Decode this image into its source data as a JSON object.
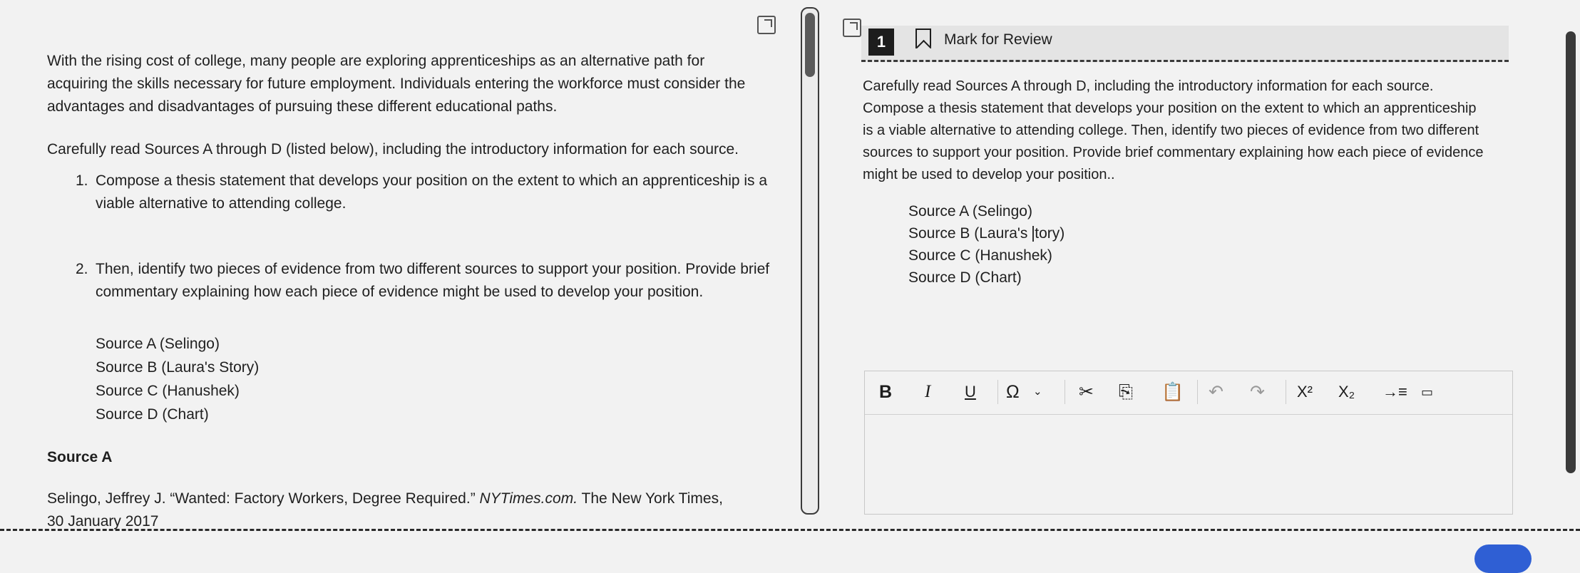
{
  "left": {
    "intro": "With the rising cost of college, many people are exploring apprenticeships as an alternative path for acquiring the skills necessary for future employment. Individuals entering the workforce must consider the advantages and disadvantages of pursuing these different educational paths.",
    "instruction": "Carefully read Sources A through D (listed below), including the introductory information for each source.",
    "steps": [
      {
        "number": "1.",
        "text": "Compose a thesis statement that develops your position on the extent to which an apprenticeship is a viable alternative to attending college."
      },
      {
        "number": "2.",
        "text": "Then, identify two pieces of evidence from two different sources to support your position. Provide brief commentary explaining how each piece of evidence might be used to develop your position."
      }
    ],
    "sources": [
      "Source A (Selingo)",
      "Source B (Laura's Story)",
      "Source C (Hanushek)",
      "Source D (Chart)"
    ],
    "source_a_heading": "Source A",
    "citation_prefix": "Selingo, Jeffrey J. “Wanted: Factory Workers, Degree Required.” ",
    "citation_italic": "NYTimes.com.",
    "citation_suffix": " The New York Times, 30 January 2017"
  },
  "question": {
    "number": "1",
    "mark_label": "Mark for Review",
    "prompt": "Carefully read Sources A through D, including the introductory information for each source. Compose a thesis statement that develops your position on the extent to which an apprenticeship is a viable alternative to attending college. Then, identify two pieces of evidence from two different sources to support your position. Provide brief commentary explaining how each piece of evidence might be used to develop your position..",
    "sources": {
      "a": "Source A (Selingo)",
      "b_before": "Source B (Laura's ",
      "b_after": "tory)",
      "c": "Source C (Hanushek)",
      "d": "Source D (Chart)"
    }
  },
  "editor": {
    "toolbar": {
      "bold": "B",
      "italic": "I",
      "underline": "U",
      "omega": "Ω",
      "chevron": "⌄",
      "cut": "✂",
      "copy": "⎘",
      "paste": "📋",
      "undo": "↶",
      "redo": "↷",
      "superscript": "X²",
      "subscript": "X₂",
      "indent": "→≡",
      "special": "▭"
    },
    "content": ""
  }
}
